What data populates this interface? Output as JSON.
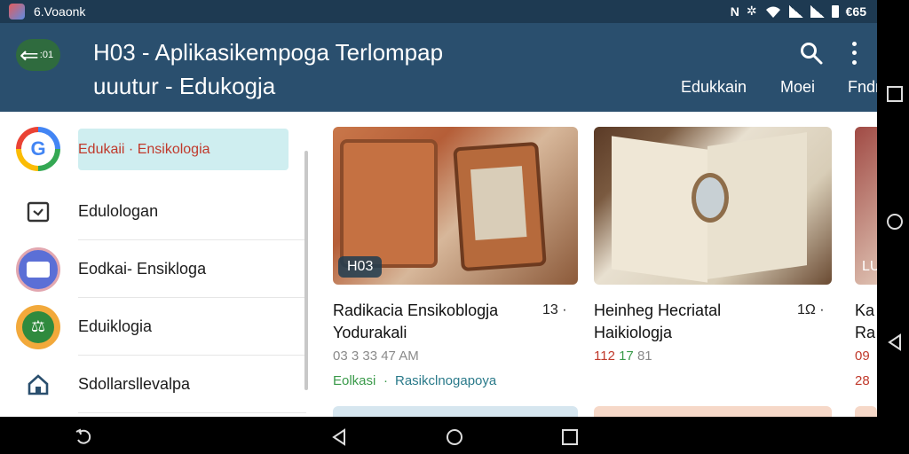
{
  "status_bar": {
    "app_name": "6.Voaonk",
    "right_text": "N",
    "battery_text": "€65"
  },
  "app_bar": {
    "back_badge": ":01",
    "title": "H03 - Aplikasikempoga Terlompap",
    "subtitle": "uuutur - Edukogja",
    "tabs": [
      "Edukkain",
      "Moei",
      "Fndm"
    ]
  },
  "sidebar": {
    "items": [
      {
        "label": "Edukaii · Ensikologia",
        "icon": "google-icon",
        "active": true
      },
      {
        "label": "Edulologan",
        "icon": "checkbox-icon",
        "active": false
      },
      {
        "label": "Eodkai- Ensikloga",
        "icon": "card-icon",
        "active": false
      },
      {
        "label": "Eduiklogia",
        "icon": "scale-icon",
        "active": false
      },
      {
        "label": "Sdollarsllevalpa",
        "icon": "home-icon",
        "active": false
      }
    ]
  },
  "cards": [
    {
      "badge": "H03",
      "title": "Radikacia Ensikoblogja",
      "subtitle": "Yodurakali",
      "count": "13 ·",
      "meta": "03 3 33 47 AM",
      "tag_left": "Eolkasi",
      "tag_right": "Rasikclnogapoya"
    },
    {
      "title": "Heinheg Hecriatal",
      "subtitle": "Haikiologja",
      "count": "1Ω ·",
      "meta_red": "112",
      "meta_green": "17",
      "meta_rest": "81"
    },
    {
      "badge": "LU",
      "title": "Ka",
      "subtitle": "Ra",
      "meta": "09",
      "meta2": "28"
    }
  ],
  "colors": {
    "app_bar": "#2a4f6e",
    "status_bar": "#1e3a52",
    "active_item": "#cfeef0",
    "active_text": "#c0392b",
    "tag_green": "#3a9a4a",
    "tag_teal": "#2a7a8a"
  }
}
